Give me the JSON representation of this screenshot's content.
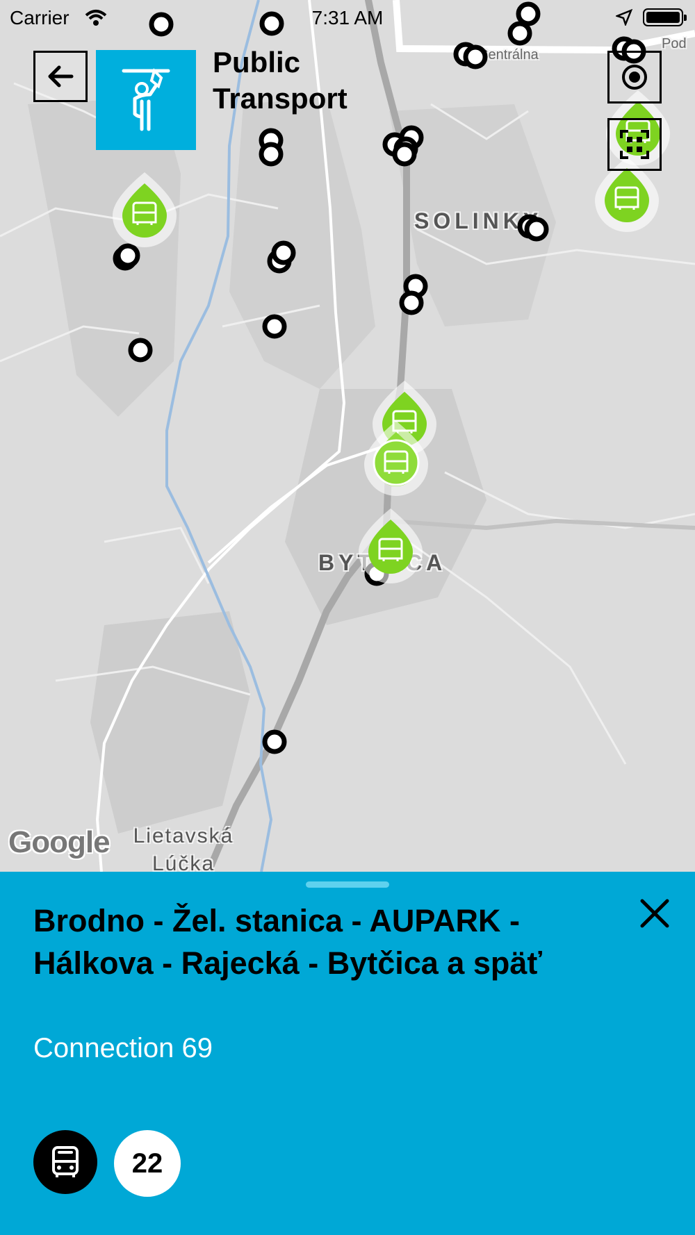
{
  "status_bar": {
    "carrier": "Carrier",
    "time": "7:31 AM"
  },
  "header": {
    "title": "Public Transport",
    "back_icon": "arrow-left-icon",
    "category_icon": "standing-passenger-icon"
  },
  "map_controls": {
    "locate_icon": "my-location-icon",
    "scan_icon": "qr-scan-icon"
  },
  "map": {
    "labels": {
      "district_north": "SOLINKY",
      "district_south": "BYTČICA",
      "area_southwest": "Lietavská Lúčka",
      "street_top": "Centrálna",
      "street_top_right": "Pod"
    },
    "provider": "Google",
    "colors": {
      "background": "#dcdcdc",
      "road": "#ffffff",
      "major_road": "#a6a6a6",
      "river": "#9bbde0",
      "stop_marker": "#000000",
      "vehicle_marker": "#7ed321"
    }
  },
  "detail_sheet": {
    "route_title": "Brodno - Žel. stanica - AUPARK - Hálkova - Rajecká - Bytčica a späť",
    "connection": "Connection 69",
    "vehicle_type_icon": "bus-icon",
    "line_number": "22",
    "close_icon": "close-icon",
    "color": "#00a8d6"
  }
}
